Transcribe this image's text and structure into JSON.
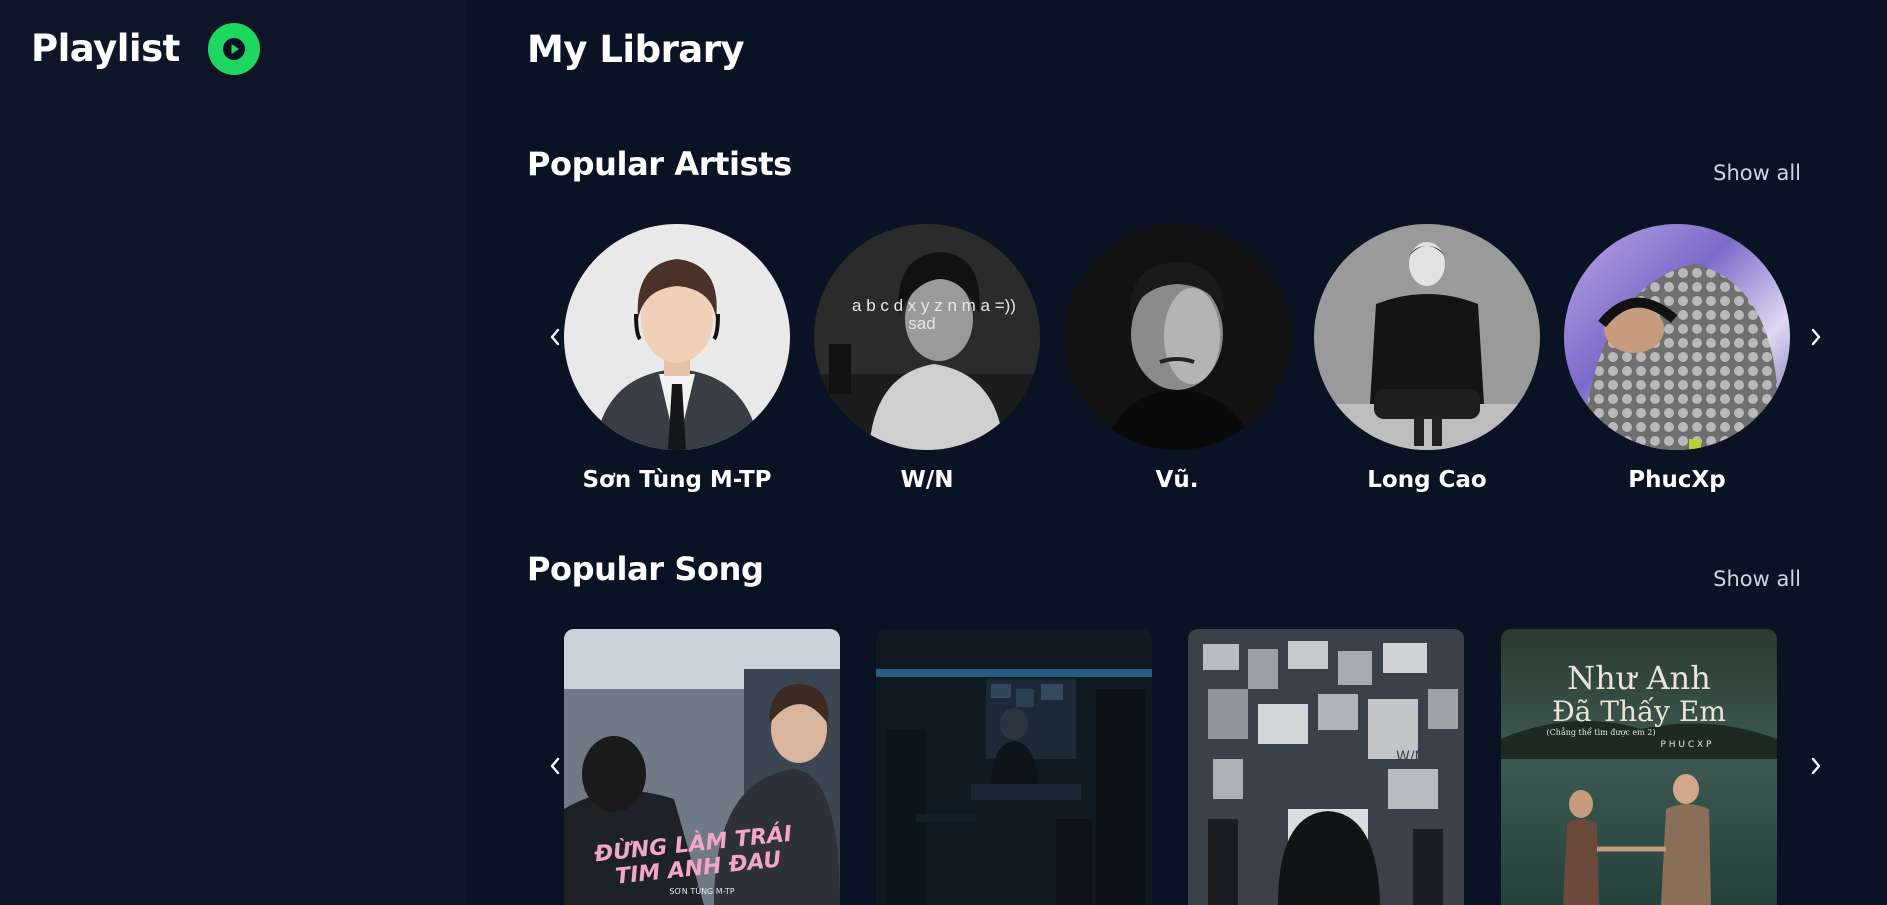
{
  "sidebar": {
    "title": "Playlist",
    "play_icon": "play-circle-icon",
    "accent": "#1ed760"
  },
  "main": {
    "title": "My Library",
    "artists_section": {
      "title": "Popular Artists",
      "show_all": "Show all",
      "artists": [
        {
          "name": "Sơn Tùng M-TP"
        },
        {
          "name": "W/N",
          "overlay_line1": "a b c d x y z n m a =))",
          "overlay_line2": "sad"
        },
        {
          "name": "Vũ."
        },
        {
          "name": "Long Cao"
        },
        {
          "name": "PhucXp"
        }
      ]
    },
    "songs_section": {
      "title": "Popular Song",
      "show_all": "Show all",
      "songs": [
        {
          "cover_line1": "ĐỪNG LÀM TRÁI",
          "cover_line2": "TIM ANH ĐAU",
          "cover_artist": "SƠN TÙNG M-TP"
        },
        {},
        {
          "cover_tag": "W/N"
        },
        {
          "cover_line1": "Như Anh",
          "cover_line2": "Đã Thấy Em",
          "cover_sub": "(Chẳng thể tìm được em 2)",
          "cover_artist": "P H U C X P"
        }
      ]
    }
  },
  "icons": {
    "prev": "chevron-left-icon",
    "next": "chevron-right-icon"
  }
}
